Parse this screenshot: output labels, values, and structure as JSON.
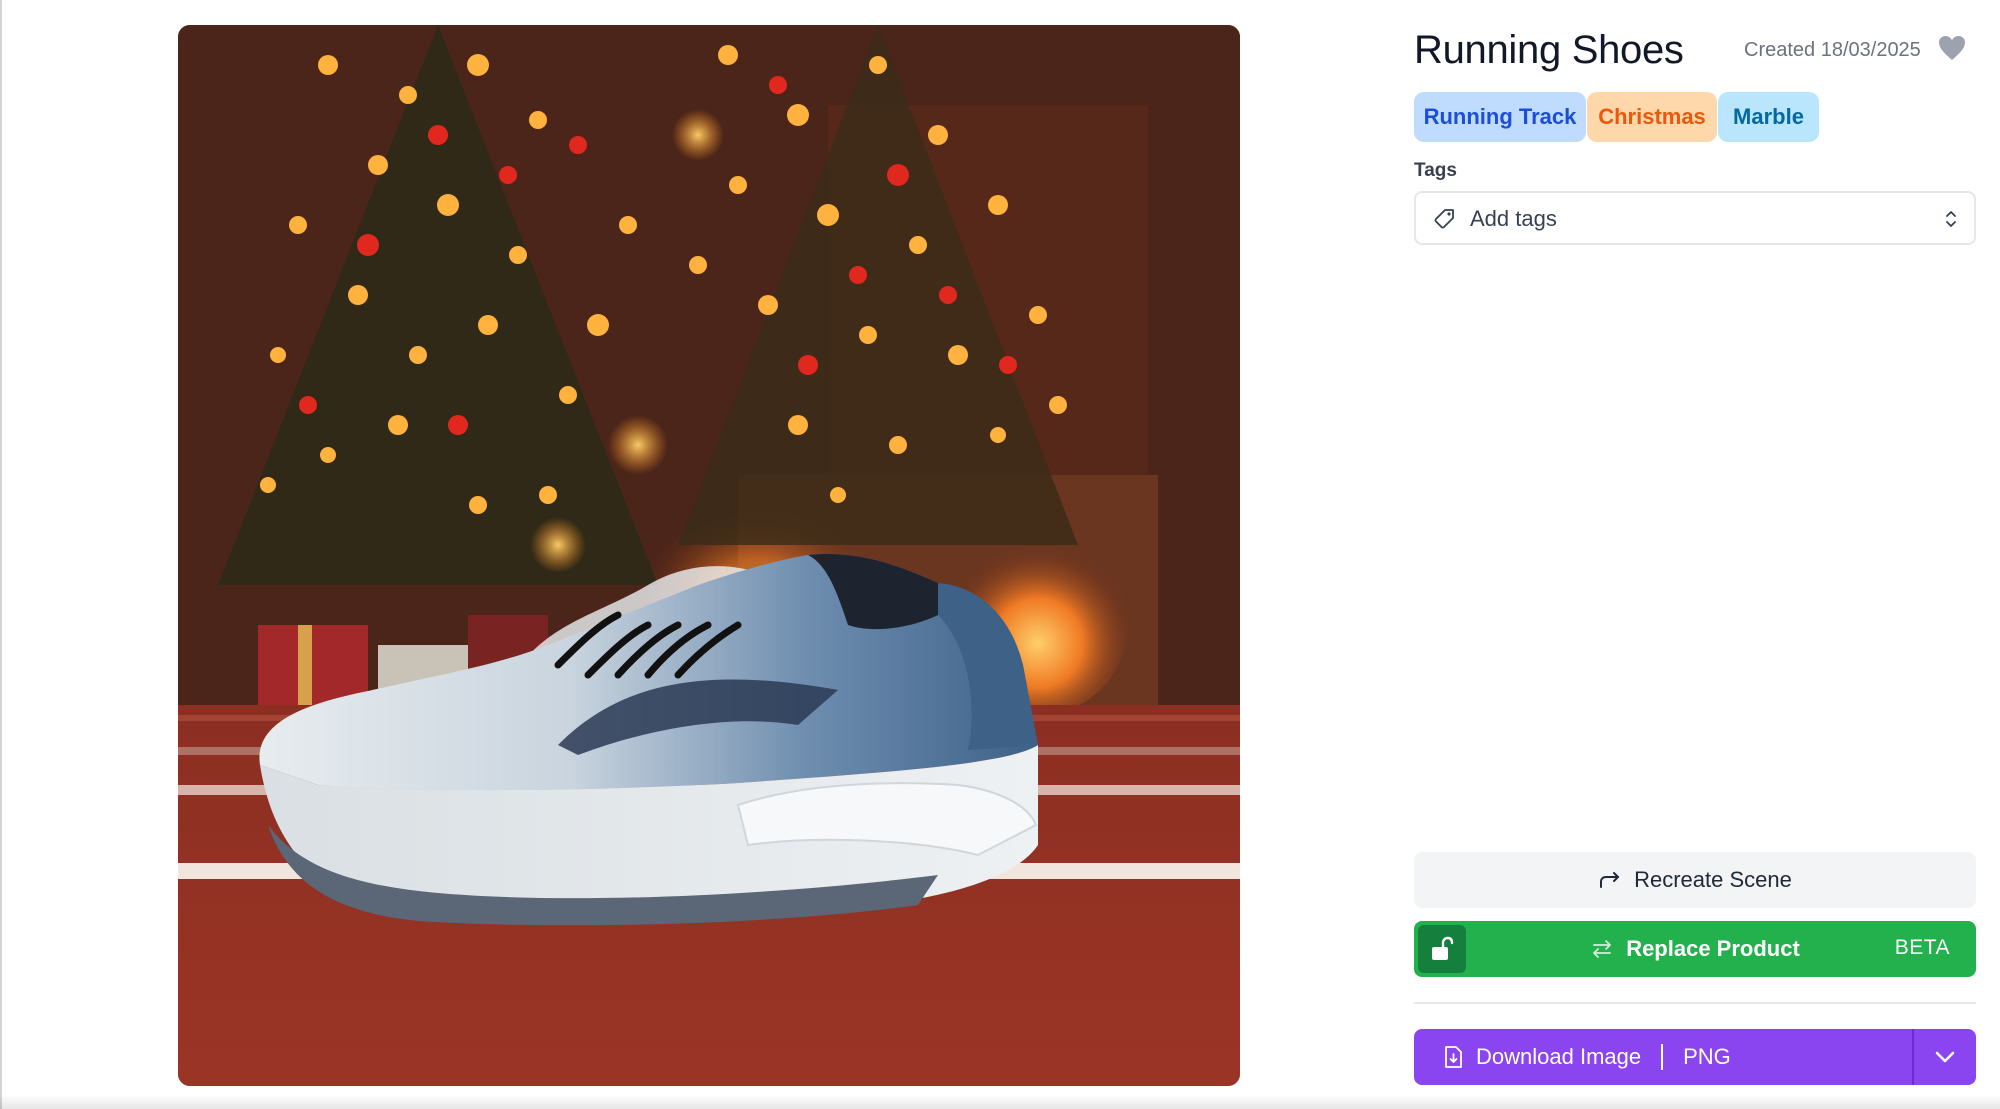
{
  "product": {
    "title": "Running Shoes",
    "created": "Created 18/03/2025",
    "favorite_icon": "heart-icon"
  },
  "style_chips": [
    {
      "label": "Running Track",
      "color": "#1d4ed8",
      "bg": "#bfdbfe"
    },
    {
      "label": "Christmas",
      "color": "#ea580c",
      "bg": "#fed7aa"
    },
    {
      "label": "Marble",
      "color": "#0369a1",
      "bg": "#bae6fd"
    }
  ],
  "tags": {
    "label": "Tags",
    "placeholder": "Add tags",
    "icon": "tag-icon"
  },
  "actions": {
    "recreate": {
      "label": "Recreate Scene",
      "icon": "redo-arrow-icon"
    },
    "replace": {
      "label": "Replace Product",
      "badge": "BETA",
      "icon": "swap-arrows-icon",
      "lock_icon": "unlock-icon",
      "color": "#22b14c"
    },
    "download": {
      "label": "Download Image",
      "format": "PNG",
      "icon": "file-download-icon",
      "color": "#8b45f0"
    }
  }
}
